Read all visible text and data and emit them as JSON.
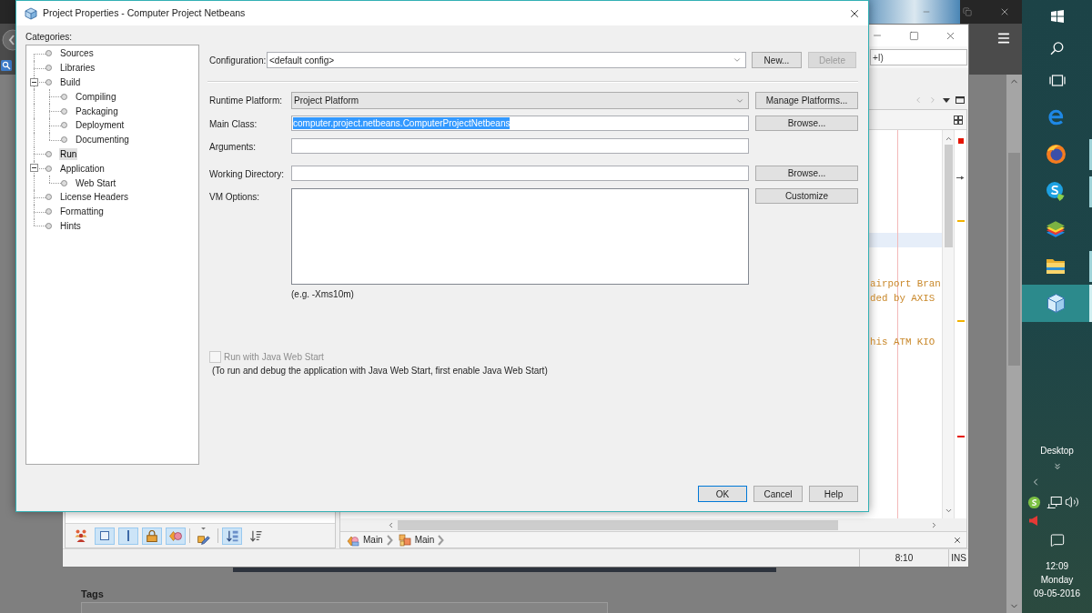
{
  "dialog": {
    "title": "Project Properties - Computer Project Netbeans",
    "categories_label": "Categories:",
    "categories": [
      {
        "label": "Sources",
        "selected": false
      },
      {
        "label": "Libraries",
        "selected": false
      },
      {
        "label": "Build",
        "selected": false,
        "expanded": true,
        "children": [
          {
            "label": "Compiling",
            "selected": false
          },
          {
            "label": "Packaging",
            "selected": false
          },
          {
            "label": "Deployment",
            "selected": false
          },
          {
            "label": "Documenting",
            "selected": false
          }
        ]
      },
      {
        "label": "Run",
        "selected": true
      },
      {
        "label": "Application",
        "selected": false,
        "expanded": true,
        "children": [
          {
            "label": "Web Start",
            "selected": false
          }
        ]
      },
      {
        "label": "License Headers",
        "selected": false
      },
      {
        "label": "Formatting",
        "selected": false
      },
      {
        "label": "Hints",
        "selected": false
      }
    ],
    "configuration": {
      "label": "Configuration:",
      "value": "<default config>",
      "buttons": [
        {
          "label": "New...",
          "disabled": false
        },
        {
          "label": "Delete",
          "disabled": true
        }
      ]
    },
    "fields": [
      {
        "kind": "combo",
        "label": "Runtime Platform:",
        "value": "Project Platform",
        "button": "Manage Platforms..."
      },
      {
        "kind": "text",
        "label": "Main Class:",
        "value": "computer.project.netbeans.ComputerProjectNetbeans",
        "highlighted": true,
        "button": "Browse..."
      },
      {
        "kind": "text",
        "label": "Arguments:"
      },
      {
        "kind": "text",
        "label": "Working Directory:",
        "button": "Browse..."
      },
      {
        "kind": "area",
        "label": "VM Options:",
        "button": "Customize",
        "hint": "(e.g. -Xms10m)"
      }
    ],
    "web_start": {
      "label": "Run with Java Web Start",
      "checked": false,
      "disabled": true,
      "note": "(To run and debug the application with Java Web Start, first enable Java Web Start)"
    },
    "buttons": [
      {
        "label": "OK",
        "default": true
      },
      {
        "label": "Cancel",
        "default": false
      },
      {
        "label": "Help",
        "default": false
      }
    ]
  },
  "ide": {
    "search": {
      "placeholder": "+I)"
    },
    "editor": {
      "lines": [
        {
          "current": false
        },
        {
          "current": false
        },
        {
          "current": false
        },
        {
          "current": false
        },
        {
          "current": false
        },
        {
          "current": false
        },
        {
          "current": false
        },
        {
          "current": true
        },
        {
          "current": false
        },
        {
          "current": false
        },
        {
          "text": "airport Bran",
          "current": false
        },
        {
          "text": "ded by AXIS",
          "current": false
        },
        {
          "current": false
        },
        {
          "current": false
        },
        {
          "text": "his ATM KIO",
          "current": false
        }
      ],
      "stripe_marks": [
        {
          "kind": "status",
          "color": "#e51400"
        },
        {
          "kind": "caret"
        },
        {
          "kind": "dash",
          "color": "#f2b200"
        },
        {
          "kind": "dash",
          "color": "#f2b200"
        },
        {
          "kind": "dash",
          "color": "#e51400"
        }
      ],
      "breadcrumbs": [
        {
          "kind": "shapes",
          "label": "Main"
        },
        {
          "kind": "boxes",
          "label": "Main"
        }
      ]
    },
    "navigator_tools": [
      {
        "kind": "group",
        "selected": false
      },
      {
        "kind": "field",
        "selected": true
      },
      {
        "kind": "bar",
        "selected": true
      },
      {
        "kind": "lock",
        "selected": true
      },
      {
        "kind": "shapes",
        "selected": true
      },
      {
        "kind": "pencil",
        "selected": false
      },
      {
        "kind": "sort",
        "selected": true
      },
      {
        "kind": "list",
        "selected": false
      }
    ],
    "status": {
      "position": "8:10",
      "mode": "INS"
    }
  },
  "browser": {
    "section_title": "Tags"
  },
  "taskbar": {
    "apps": [
      {
        "kind": "letter",
        "running": false,
        "selected": false
      },
      {
        "kind": "globe",
        "running": true,
        "selected": false
      },
      {
        "kind": "chat",
        "running": true,
        "selected": false
      },
      {
        "kind": "layers",
        "running": false,
        "selected": false
      },
      {
        "kind": "folder",
        "running": true,
        "selected": false
      },
      {
        "kind": "cube",
        "running": true,
        "selected": true
      }
    ],
    "desktop_label": "Desktop",
    "clock": {
      "time": "12:09",
      "day": "Monday",
      "date": "09-05-2016"
    }
  }
}
